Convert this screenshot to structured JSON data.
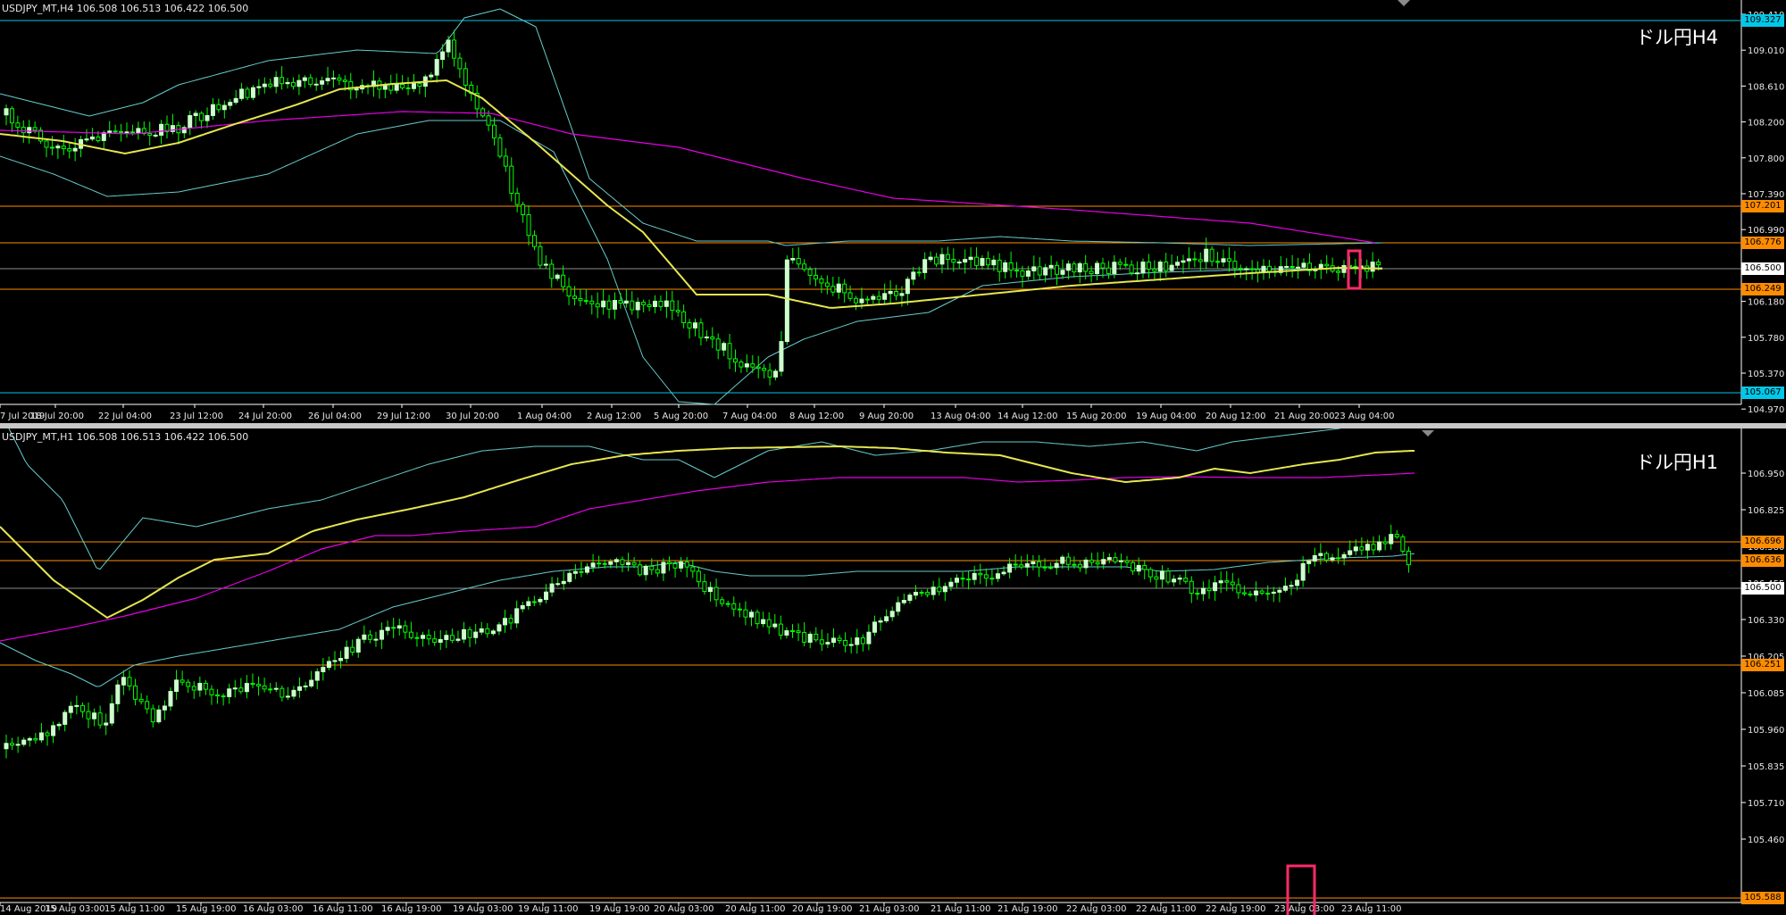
{
  "charts": [
    {
      "id": "h4",
      "header": "USDJPY_MT,H4  106.508 106.513 106.422 106.500",
      "label": "ドル円H4",
      "price_ticks": [
        "109.410",
        "109.010",
        "108.610",
        "108.200",
        "107.800",
        "107.390",
        "106.990",
        "106.590",
        "106.180",
        "105.780",
        "105.370",
        "104.970"
      ],
      "levels": [
        {
          "value": "109.327",
          "color": "#00c8e8"
        },
        {
          "value": "107.201",
          "color": "#ff8c00"
        },
        {
          "value": "106.776",
          "color": "#ff8c00"
        },
        {
          "value": "106.500",
          "color": "#ffffff"
        },
        {
          "value": "106.249",
          "color": "#ff8c00"
        },
        {
          "value": "105.067",
          "color": "#00c8e8"
        }
      ],
      "time_labels": [
        "7 Jul 2019",
        "18 Jul 20:00",
        "22 Jul 04:00",
        "23 Jul 12:00",
        "24 Jul 20:00",
        "26 Jul 04:00",
        "29 Jul 12:00",
        "30 Jul 20:00",
        "1 Aug 04:00",
        "2 Aug 12:00",
        "5 Aug 20:00",
        "7 Aug 04:00",
        "8 Aug 12:00",
        "9 Aug 20:00",
        "13 Aug 04:00",
        "14 Aug 12:00",
        "15 Aug 20:00",
        "19 Aug 04:00",
        "20 Aug 12:00",
        "21 Aug 20:00",
        "23 Aug 04:00"
      ]
    },
    {
      "id": "h1",
      "header": "USDJPY_MT,H1  106.508 106.513 106.422 106.500",
      "label": "ドル円H1",
      "price_ticks": [
        "106.950",
        "106.825",
        "106.580",
        "106.455",
        "106.330",
        "106.205",
        "106.085",
        "105.960",
        "105.835",
        "105.710",
        "105.460"
      ],
      "levels": [
        {
          "value": "106.696",
          "color": "#ff8c00"
        },
        {
          "value": "106.636",
          "color": "#ff8c00"
        },
        {
          "value": "106.500",
          "color": "#ffffff"
        },
        {
          "value": "106.251",
          "color": "#ff8c00"
        },
        {
          "value": "105.588",
          "color": "#ff8c00"
        }
      ],
      "time_labels": [
        "14 Aug 2019",
        "15 Aug 03:00",
        "15 Aug 11:00",
        "15 Aug 19:00",
        "16 Aug 03:00",
        "16 Aug 11:00",
        "16 Aug 19:00",
        "19 Aug 03:00",
        "19 Aug 11:00",
        "19 Aug 19:00",
        "20 Aug 03:00",
        "20 Aug 11:00",
        "20 Aug 19:00",
        "21 Aug 03:00",
        "21 Aug 11:00",
        "21 Aug 19:00",
        "22 Aug 03:00",
        "22 Aug 11:00",
        "22 Aug 19:00",
        "23 Aug 03:00",
        "23 Aug 11:00"
      ]
    }
  ],
  "colors": {
    "candle": "#ccffcc",
    "wick": "#00ff00",
    "ma_fast": "#e6e650",
    "ma_slow": "#e600e6",
    "bands": "#66cccc",
    "highlight": "#ff2a6a",
    "axis_text": "#e6e6e6"
  }
}
